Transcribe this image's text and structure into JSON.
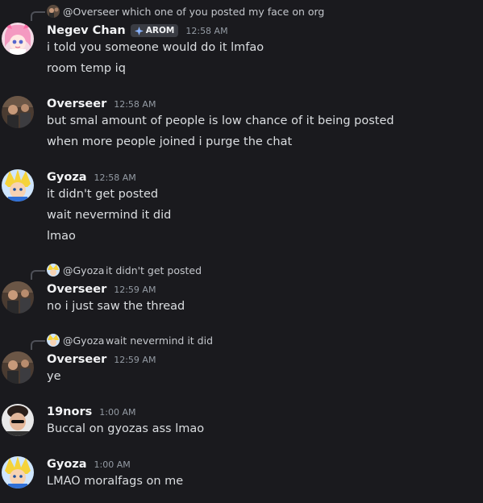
{
  "colors": {
    "background": "#1a1a1e",
    "username": "#f2f3f5",
    "timestamp": "#949ba4",
    "message_text": "#dbdee1",
    "reply_spine": "#4e5058"
  },
  "messages": [
    {
      "reply": {
        "name": "@Overseer",
        "text": "which one of you posted my face on org"
      },
      "author": "Negev Chan",
      "tag": "AROM",
      "time": "12:58 AM",
      "lines": [
        "i told you someone would do it lmfao",
        "room temp iq"
      ]
    },
    {
      "author": "Overseer",
      "time": "12:58 AM",
      "lines": [
        "but smal amount of people is low chance of it being posted",
        "when more people joined i purge the chat"
      ]
    },
    {
      "author": "Gyoza",
      "time": "12:58 AM",
      "lines": [
        "it didn't get posted",
        "wait nevermind it did",
        "lmao"
      ]
    },
    {
      "reply": {
        "name": "@Gyoza",
        "text": "it didn't get posted"
      },
      "author": "Overseer",
      "time": "12:59 AM",
      "lines": [
        "no i just saw the thread"
      ]
    },
    {
      "reply": {
        "name": "@Gyoza",
        "text": "wait nevermind it did"
      },
      "author": "Overseer",
      "time": "12:59 AM",
      "lines": [
        "ye"
      ]
    },
    {
      "author": "19nors",
      "time": "1:00 AM",
      "lines": [
        "Buccal on gyozas ass lmao"
      ]
    },
    {
      "author": "Gyoza",
      "time": "1:00 AM",
      "lines": [
        "LMAO moralfags on me"
      ]
    }
  ]
}
